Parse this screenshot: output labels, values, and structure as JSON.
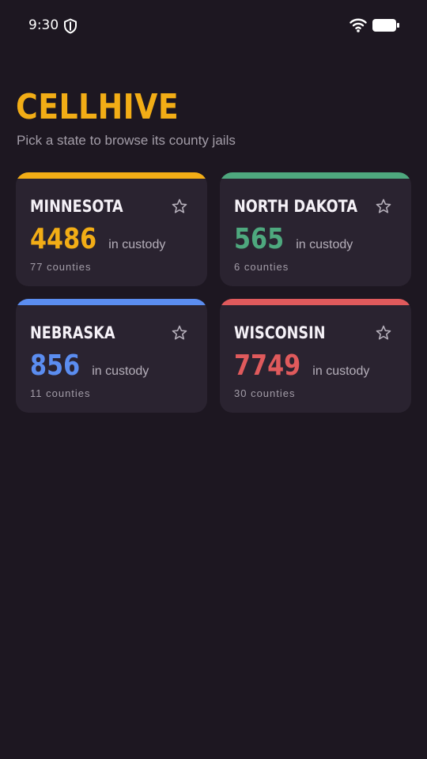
{
  "status_bar": {
    "time": "9:30",
    "shield_icon": "shield-icon",
    "wifi_icon": "wifi-icon",
    "battery_icon": "battery-icon"
  },
  "header": {
    "title": "CELLHIVE",
    "subtitle": "Pick a state to browse its county jails"
  },
  "colors": {
    "background": "#1d1721",
    "card": "#2a2330",
    "brand": "#f2ad16"
  },
  "states": [
    {
      "name": "MINNESOTA",
      "count": "4486",
      "count_label": "in custody",
      "counties": "77 counties",
      "accent": "#f2ad16",
      "icon": "star-icon"
    },
    {
      "name": "NORTH DAKOTA",
      "count": "565",
      "count_label": "in custody",
      "counties": "6 counties",
      "accent": "#4ea87e",
      "icon": "star-icon"
    },
    {
      "name": "NEBRASKA",
      "count": "856",
      "count_label": "in custody",
      "counties": "11 counties",
      "accent": "#5b8df0",
      "icon": "star-icon"
    },
    {
      "name": "WISCONSIN",
      "count": "7749",
      "count_label": "in custody",
      "counties": "30 counties",
      "accent": "#e05a5c",
      "icon": "star-icon"
    }
  ]
}
